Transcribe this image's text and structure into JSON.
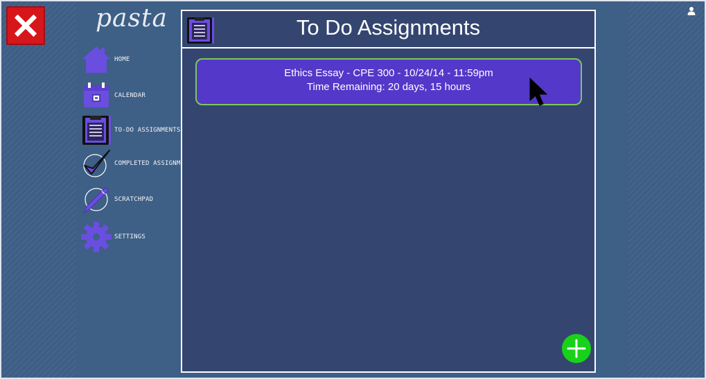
{
  "app": {
    "brand": "pasta"
  },
  "close_button": {
    "icon": "close-x-icon",
    "color": "#d5161b"
  },
  "user_button": {
    "icon": "user-icon"
  },
  "sidebar": {
    "items": [
      {
        "label": "HOME",
        "icon": "home-icon"
      },
      {
        "label": "CALENDAR",
        "icon": "calendar-icon"
      },
      {
        "label": "TO-DO ASSIGNMENTS",
        "icon": "clipboard-icon"
      },
      {
        "label": "COMPLETED ASSIGNMENTS",
        "icon": "checkmark-icon"
      },
      {
        "label": "SCRATCHPAD",
        "icon": "pen-icon"
      },
      {
        "label": "SETTINGS",
        "icon": "gear-icon"
      }
    ]
  },
  "main": {
    "title": "To Do Assignments",
    "header_icon": "clipboard-icon",
    "assignments": [
      {
        "line1": "Ethics Essay - CPE 300 - 10/24/14 - 11:59pm",
        "line2": "Time Remaining: 20 days, 15 hours"
      }
    ],
    "add_button": {
      "icon": "plus-icon",
      "color": "#19d11a"
    }
  },
  "colors": {
    "background": "#3e5f86",
    "panel": "#344670",
    "card": "#5338c9",
    "card_border": "#7fc75a",
    "accent_purple": "#6a4ee0"
  }
}
